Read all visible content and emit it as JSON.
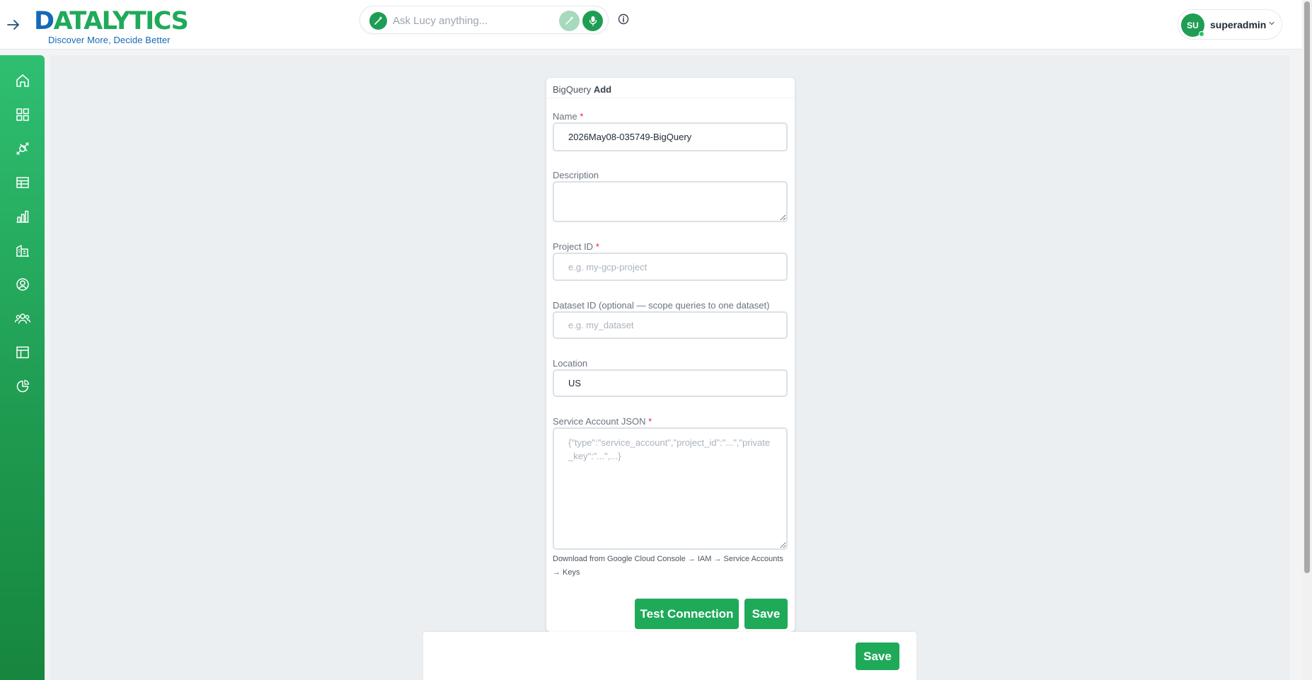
{
  "header": {
    "logo_text_1": "D",
    "logo_text_2": "ATALYTICS",
    "logo_tagline": "Discover More, Decide Better",
    "search_placeholder": "Ask Lucy anything...",
    "user_initials": "SU",
    "user_name": "superadmin"
  },
  "sidebar": {
    "items": [
      {
        "icon": "home-icon"
      },
      {
        "icon": "dashboard-grid-icon"
      },
      {
        "icon": "connector-plug-icon"
      },
      {
        "icon": "table-icon"
      },
      {
        "icon": "bar-chart-icon"
      },
      {
        "icon": "building-icon"
      },
      {
        "icon": "user-circle-icon"
      },
      {
        "icon": "users-group-icon"
      },
      {
        "icon": "layout-icon"
      },
      {
        "icon": "pie-chart-icon"
      }
    ]
  },
  "form": {
    "title_prefix": "BigQuery",
    "title_action": "Add",
    "name": {
      "label": "Name",
      "required_mark": "*",
      "value": "2026May08-035749-BigQuery"
    },
    "description": {
      "label": "Description",
      "value": ""
    },
    "project_id": {
      "label": "Project ID",
      "required_mark": "*",
      "placeholder": "e.g. my-gcp-project"
    },
    "dataset_id": {
      "label": "Dataset ID (optional — scope queries to one dataset)",
      "placeholder": "e.g. my_dataset"
    },
    "location": {
      "label": "Location",
      "value": "US"
    },
    "service_account": {
      "label": "Service Account JSON",
      "required_mark": "*",
      "placeholder": "{\"type\":\"service_account\",\"project_id\":\"...\",\"private_key\":\"...\",...}",
      "hint": "Download from Google Cloud Console → IAM → Service Accounts → Keys"
    },
    "test_button": "Test Connection",
    "save_button": "Save"
  },
  "footer": {
    "save_button": "Save"
  },
  "colors": {
    "brand_green": "#1faa5a",
    "brand_blue": "#1469b8",
    "required_red": "#e11d48"
  }
}
